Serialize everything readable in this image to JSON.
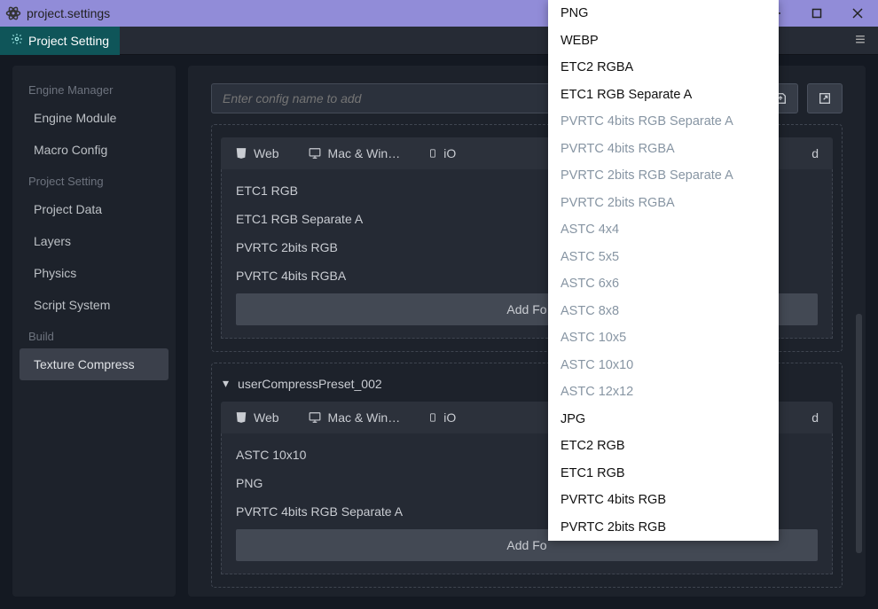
{
  "titlebar": {
    "title": "project.settings"
  },
  "tabbar": {
    "project_setting": "Project Setting"
  },
  "sidebar": {
    "sections": {
      "engine_manager": "Engine Manager",
      "project_setting": "Project Setting",
      "build": "Build"
    },
    "items": {
      "engine_module": "Engine Module",
      "macro_config": "Macro Config",
      "project_data": "Project Data",
      "layers": "Layers",
      "physics": "Physics",
      "script_system": "Script System",
      "texture_compress": "Texture Compress"
    }
  },
  "main": {
    "config_placeholder": "Enter config name to add",
    "preset1": {
      "platform_web": "Web",
      "platform_mac": "Mac & Win…",
      "platform_ios": "iO",
      "platform_last": "d",
      "formats": [
        "ETC1 RGB",
        "ETC1 RGB Separate A",
        "PVRTC 2bits RGB",
        "PVRTC 4bits RGBA"
      ],
      "add_format": "Add Fo"
    },
    "preset2": {
      "title": "userCompressPreset_002",
      "platform_web": "Web",
      "platform_mac": "Mac & Win…",
      "platform_ios": "iO",
      "platform_last": "d",
      "formats": [
        "ASTC 10x10",
        "PNG",
        "PVRTC 4bits RGB Separate A"
      ],
      "add_format": "Add Fo"
    }
  },
  "dropdown": {
    "items": [
      {
        "label": "PNG",
        "disabled": false
      },
      {
        "label": "WEBP",
        "disabled": false
      },
      {
        "label": "ETC2 RGBA",
        "disabled": false
      },
      {
        "label": "ETC1 RGB Separate A",
        "disabled": false
      },
      {
        "label": "PVRTC 4bits RGB Separate A",
        "disabled": true
      },
      {
        "label": "PVRTC 4bits RGBA",
        "disabled": true
      },
      {
        "label": "PVRTC 2bits RGB Separate A",
        "disabled": true
      },
      {
        "label": "PVRTC 2bits RGBA",
        "disabled": true
      },
      {
        "label": "ASTC 4x4",
        "disabled": true
      },
      {
        "label": "ASTC 5x5",
        "disabled": true
      },
      {
        "label": "ASTC 6x6",
        "disabled": true
      },
      {
        "label": "ASTC 8x8",
        "disabled": true
      },
      {
        "label": "ASTC 10x5",
        "disabled": true
      },
      {
        "label": "ASTC 10x10",
        "disabled": true
      },
      {
        "label": "ASTC 12x12",
        "disabled": true
      },
      {
        "label": "JPG",
        "disabled": false
      },
      {
        "label": "ETC2 RGB",
        "disabled": false
      },
      {
        "label": "ETC1 RGB",
        "disabled": false
      },
      {
        "label": "PVRTC 4bits RGB",
        "disabled": false
      },
      {
        "label": "PVRTC 2bits RGB",
        "disabled": false
      }
    ]
  }
}
